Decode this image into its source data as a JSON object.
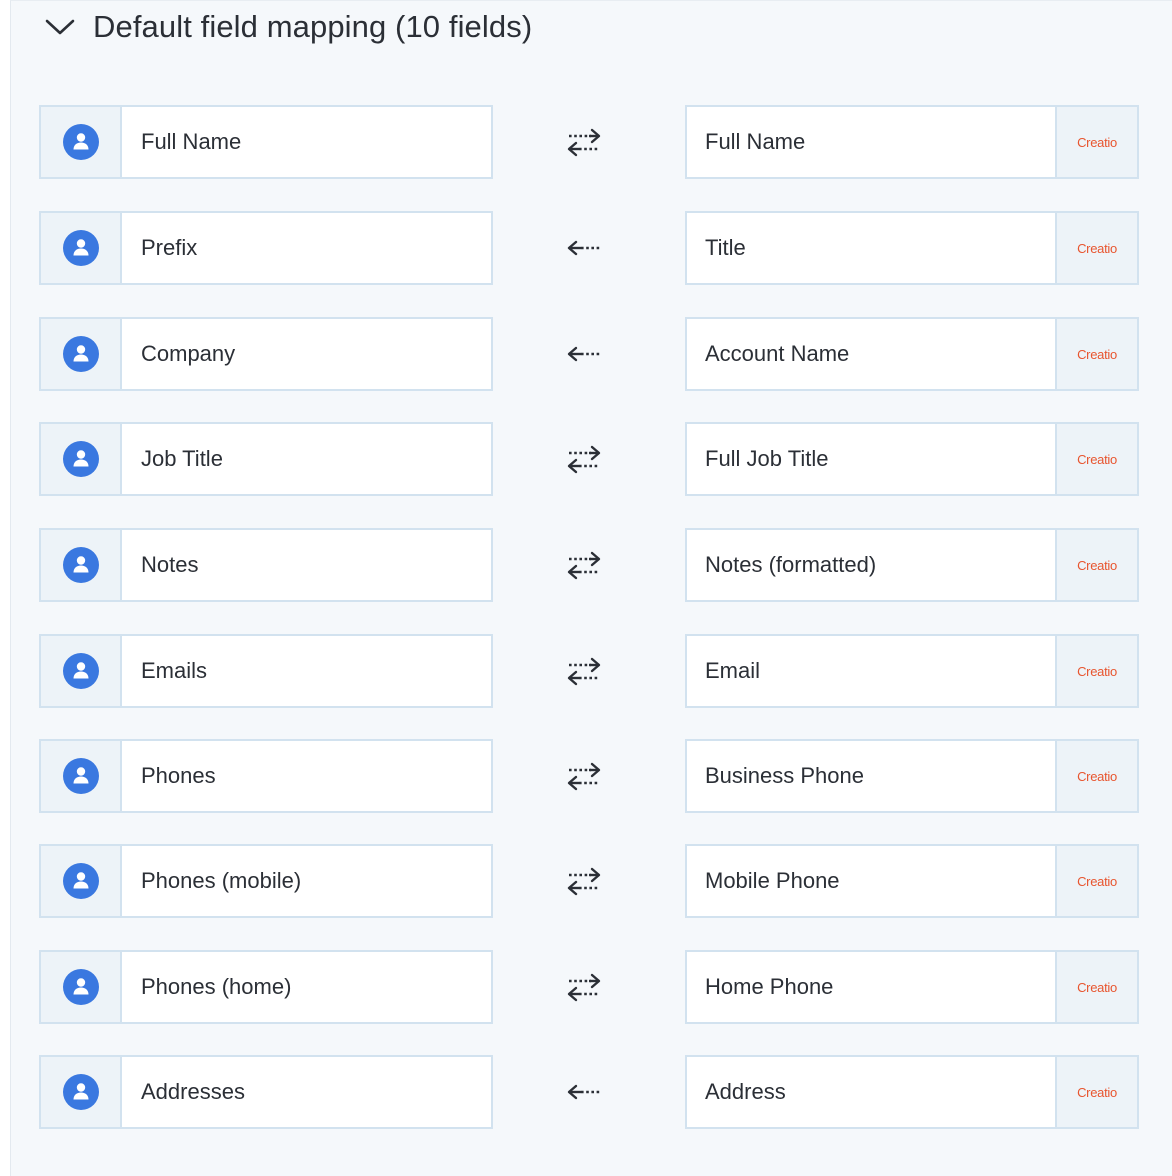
{
  "section": {
    "title": "Default field mapping (10 fields)"
  },
  "colors": {
    "accent": "#3a78e0",
    "brand_logo": "#e8552f",
    "panel_bg": "#f5f8fb",
    "border": "#d2e2ef"
  },
  "mappings": [
    {
      "source": "Full Name",
      "target": "Full Name",
      "direction": "bidirectional",
      "target_logo": "Creatio",
      "source_icon": "person-icon"
    },
    {
      "source": "Prefix",
      "target": "Title",
      "direction": "to-source",
      "target_logo": "Creatio",
      "source_icon": "person-icon"
    },
    {
      "source": "Company",
      "target": "Account Name",
      "direction": "to-source",
      "target_logo": "Creatio",
      "source_icon": "person-icon"
    },
    {
      "source": "Job Title",
      "target": "Full Job Title",
      "direction": "bidirectional",
      "target_logo": "Creatio",
      "source_icon": "person-icon"
    },
    {
      "source": "Notes",
      "target": "Notes (formatted)",
      "direction": "bidirectional",
      "target_logo": "Creatio",
      "source_icon": "person-icon"
    },
    {
      "source": "Emails",
      "target": "Email",
      "direction": "bidirectional",
      "target_logo": "Creatio",
      "source_icon": "person-icon"
    },
    {
      "source": "Phones",
      "target": "Business Phone",
      "direction": "bidirectional",
      "target_logo": "Creatio",
      "source_icon": "person-icon"
    },
    {
      "source": "Phones (mobile)",
      "target": "Mobile Phone",
      "direction": "bidirectional",
      "target_logo": "Creatio",
      "source_icon": "person-icon"
    },
    {
      "source": "Phones (home)",
      "target": "Home Phone",
      "direction": "bidirectional",
      "target_logo": "Creatio",
      "source_icon": "person-icon"
    },
    {
      "source": "Addresses",
      "target": "Address",
      "direction": "to-source",
      "target_logo": "Creatio",
      "source_icon": "person-icon"
    }
  ]
}
